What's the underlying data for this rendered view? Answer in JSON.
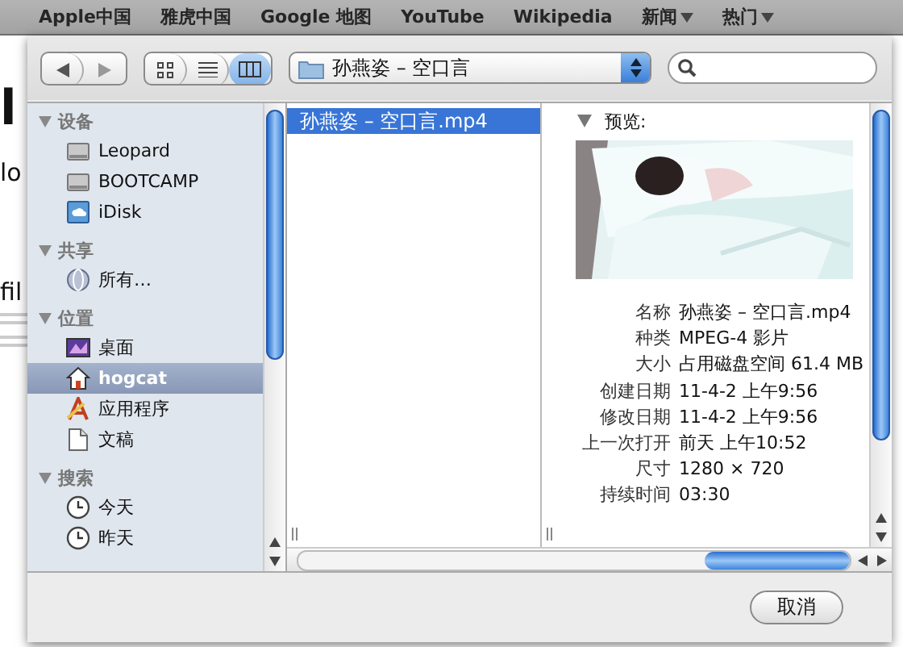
{
  "bookmarks": [
    {
      "label": "Apple中国",
      "menu": false
    },
    {
      "label": "雅虎中国",
      "menu": false
    },
    {
      "label": "Google 地图",
      "menu": false
    },
    {
      "label": "YouTube",
      "menu": false
    },
    {
      "label": "Wikipedia",
      "menu": false
    },
    {
      "label": "新闻",
      "menu": true
    },
    {
      "label": "热门",
      "menu": true
    }
  ],
  "background_page": {
    "texts": [
      {
        "text": "l",
        "kind": "heading"
      },
      {
        "text": "lo",
        "kind": "body"
      },
      {
        "text": "fil",
        "kind": "body"
      }
    ]
  },
  "toolbar": {
    "views": [
      {
        "kind": "icons",
        "selected": false
      },
      {
        "kind": "list",
        "selected": false
      },
      {
        "kind": "columns",
        "selected": true
      }
    ],
    "location": "孙燕姿 – 空口言"
  },
  "sidebar": {
    "sections": [
      {
        "title": "设备",
        "expanded": true,
        "items": [
          {
            "label": "Leopard",
            "kind": "disk",
            "selected": false
          },
          {
            "label": "BOOTCAMP",
            "kind": "disk",
            "selected": false
          },
          {
            "label": "iDisk",
            "kind": "idisk",
            "selected": false
          }
        ]
      },
      {
        "title": "共享",
        "expanded": true,
        "items": [
          {
            "label": "所有…",
            "kind": "network",
            "selected": false
          }
        ]
      },
      {
        "title": "位置",
        "expanded": true,
        "items": [
          {
            "label": "桌面",
            "kind": "desktop",
            "selected": false
          },
          {
            "label": "hogcat",
            "kind": "home",
            "selected": true
          },
          {
            "label": "应用程序",
            "kind": "apps",
            "selected": false
          },
          {
            "label": "文稿",
            "kind": "document",
            "selected": false
          }
        ]
      },
      {
        "title": "搜索",
        "expanded": true,
        "items": [
          {
            "label": "今天",
            "kind": "clock",
            "selected": false
          },
          {
            "label": "昨天",
            "kind": "clock",
            "selected": false
          }
        ]
      }
    ]
  },
  "files": [
    {
      "name": "孙燕姿 – 空口言.mp4",
      "selected": true
    }
  ],
  "preview": {
    "title": "预览:",
    "expanded": true,
    "info": [
      {
        "label": "名称",
        "value": "孙燕姿 – 空口言.mp4"
      },
      {
        "label": "种类",
        "value": "MPEG-4 影片"
      },
      {
        "label": "大小",
        "value": "占用磁盘空间 61.4 MB"
      },
      {
        "label": "创建日期",
        "value": "11-4-2 上午9:56"
      },
      {
        "label": "修改日期",
        "value": "11-4-2 上午9:56"
      },
      {
        "label": "上一次打开",
        "value": "前天 上午10:52"
      },
      {
        "label": "尺寸",
        "value": "1280 × 720"
      },
      {
        "label": "持续时间",
        "value": "03:30"
      }
    ]
  },
  "buttons": [
    {
      "label": "取消",
      "default": false
    }
  ]
}
